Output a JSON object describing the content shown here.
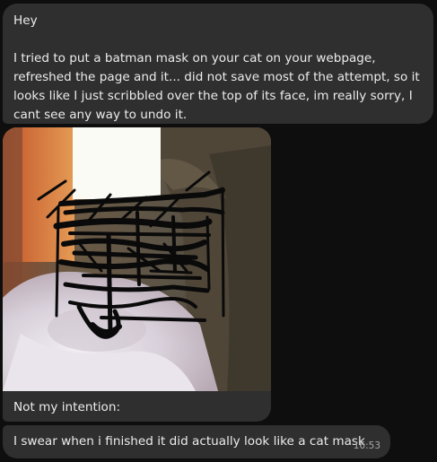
{
  "messages": [
    {
      "greeting": "Hey",
      "body": "I tried to put a batman mask on your cat on your webpage, refreshed the page and it... did not save most of the attempt, so it looks like I just scribbled over the top of its face, im really sorry, I cant see any way to undo it."
    },
    {
      "caption": "Not my intention:"
    },
    {
      "text": "I swear when i finished it did actually look like a cat mask",
      "time": "16:53"
    }
  ],
  "colors": {
    "background": "#0e0e0e",
    "bubble": "#2f2f2f",
    "text": "#ececec",
    "timestamp": "#a9a9a9"
  }
}
